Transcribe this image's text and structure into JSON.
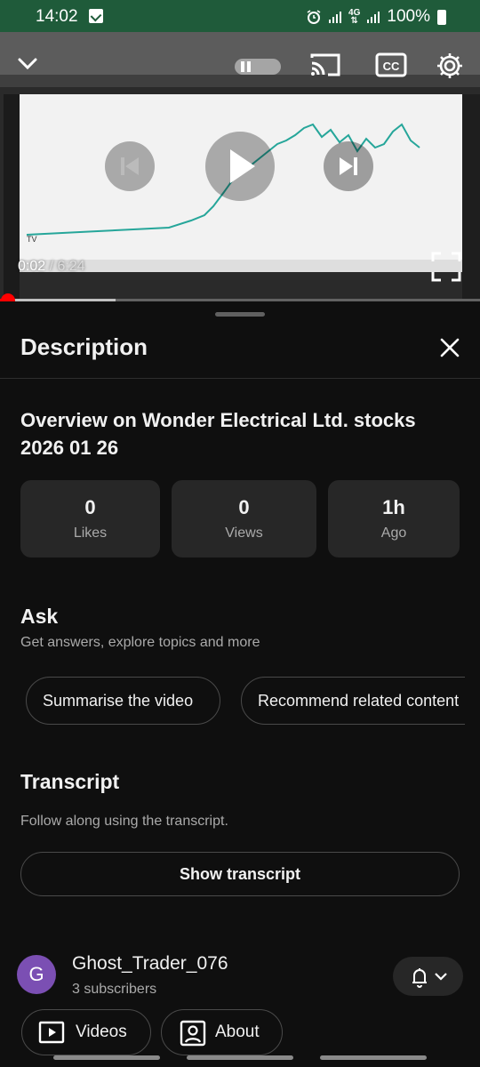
{
  "status_bar": {
    "time": "14:02",
    "network": "4G",
    "battery": "100%"
  },
  "player": {
    "current_time": "0:02",
    "separator": " / ",
    "duration": "6:24",
    "progress_fraction": 0.005,
    "buffered_fraction": 0.24,
    "accent_color": "#ff0000",
    "cc_label": "CC"
  },
  "description": {
    "heading": "Description",
    "video_title": "Overview on Wonder Electrical Ltd. stocks 2026 01 26",
    "stats": [
      {
        "value": "0",
        "label": "Likes"
      },
      {
        "value": "0",
        "label": "Views"
      },
      {
        "value": "1h",
        "label": "Ago"
      }
    ],
    "ask": {
      "heading": "Ask",
      "subtitle": "Get answers, explore topics and more",
      "chips": [
        "Summarise the video",
        "Recommend related content"
      ]
    },
    "transcript": {
      "heading": "Transcript",
      "subtitle": "Follow along using the transcript.",
      "button": "Show transcript"
    },
    "channel": {
      "avatar_letter": "G",
      "avatar_color": "#7b4fb3",
      "name": "Ghost_Trader_076",
      "subscribers": "3 subscribers",
      "videos_label": "Videos",
      "about_label": "About"
    }
  }
}
